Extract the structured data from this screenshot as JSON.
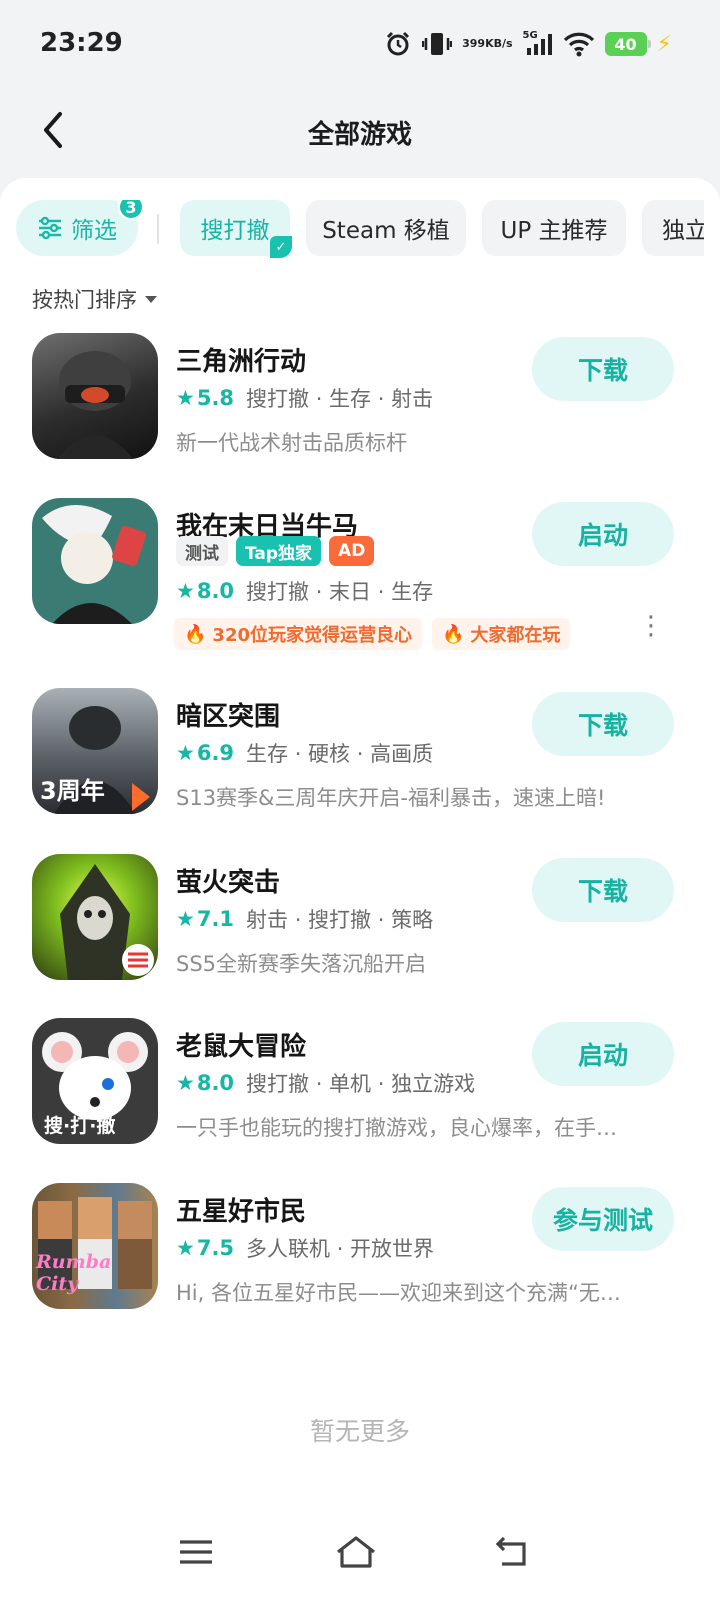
{
  "status": {
    "time": "23:29",
    "net_speed_value": "399",
    "net_speed_unit": "KB/s",
    "signal_label": "5G",
    "battery": "40",
    "icons": [
      "alarm-icon",
      "vibrate-icon",
      "signal-icon",
      "wifi-icon",
      "battery-icon",
      "charging-icon"
    ]
  },
  "header": {
    "title": "全部游戏",
    "back_icon": "back-arrow-icon"
  },
  "filters": {
    "filter_label": "筛选",
    "filter_count": "3",
    "chips": [
      "搜打撤",
      "Steam 移植",
      "UP 主推荐",
      "独立"
    ],
    "active_chip": "搜打撤"
  },
  "sort": {
    "label": "按热门排序"
  },
  "accent_color": "#19c2b0",
  "games": [
    {
      "name": "三角洲行动",
      "rating": "5.8",
      "tags": "搜打撤 · 生存 · 射击",
      "desc": "新一代战术射击品质标杆",
      "action": "下载",
      "icon_overlay": ""
    },
    {
      "name": "我在末日当牛马",
      "labels": [
        "测试",
        "Tap独家",
        "AD"
      ],
      "rating": "8.0",
      "tags": "搜打撤 · 末日 · 生存",
      "hot": [
        "320位玩家觉得运营良心",
        "大家都在玩"
      ],
      "action": "启动",
      "icon_overlay": ""
    },
    {
      "name": "暗区突围",
      "rating": "6.9",
      "tags": "生存 · 硬核 · 高画质",
      "desc": "S13赛季&三周年庆开启-福利暴击，速速上暗!",
      "action": "下载",
      "icon_overlay": "3周年"
    },
    {
      "name": "萤火突击",
      "rating": "7.1",
      "tags": "射击 · 搜打撤 · 策略",
      "desc": "SS5全新赛季失落沉船开启",
      "action": "下载",
      "icon_overlay": ""
    },
    {
      "name": "老鼠大冒险",
      "rating": "8.0",
      "tags": "搜打撤 · 单机 · 独立游戏",
      "desc": "一只手也能玩的搜打撤游戏，良心爆率，在手…",
      "action": "启动",
      "icon_overlay": "搜·打·撤"
    },
    {
      "name": "五星好市民",
      "rating": "7.5",
      "tags": "多人联机 · 开放世界",
      "desc": "Hi, 各位五星好市民——欢迎来到这个充满“无…",
      "action": "参与测试",
      "icon_overlay": "Rumba City"
    }
  ],
  "footer": {
    "no_more": "暂无更多"
  },
  "system_nav": [
    "menu-icon",
    "home-icon",
    "back-icon"
  ]
}
